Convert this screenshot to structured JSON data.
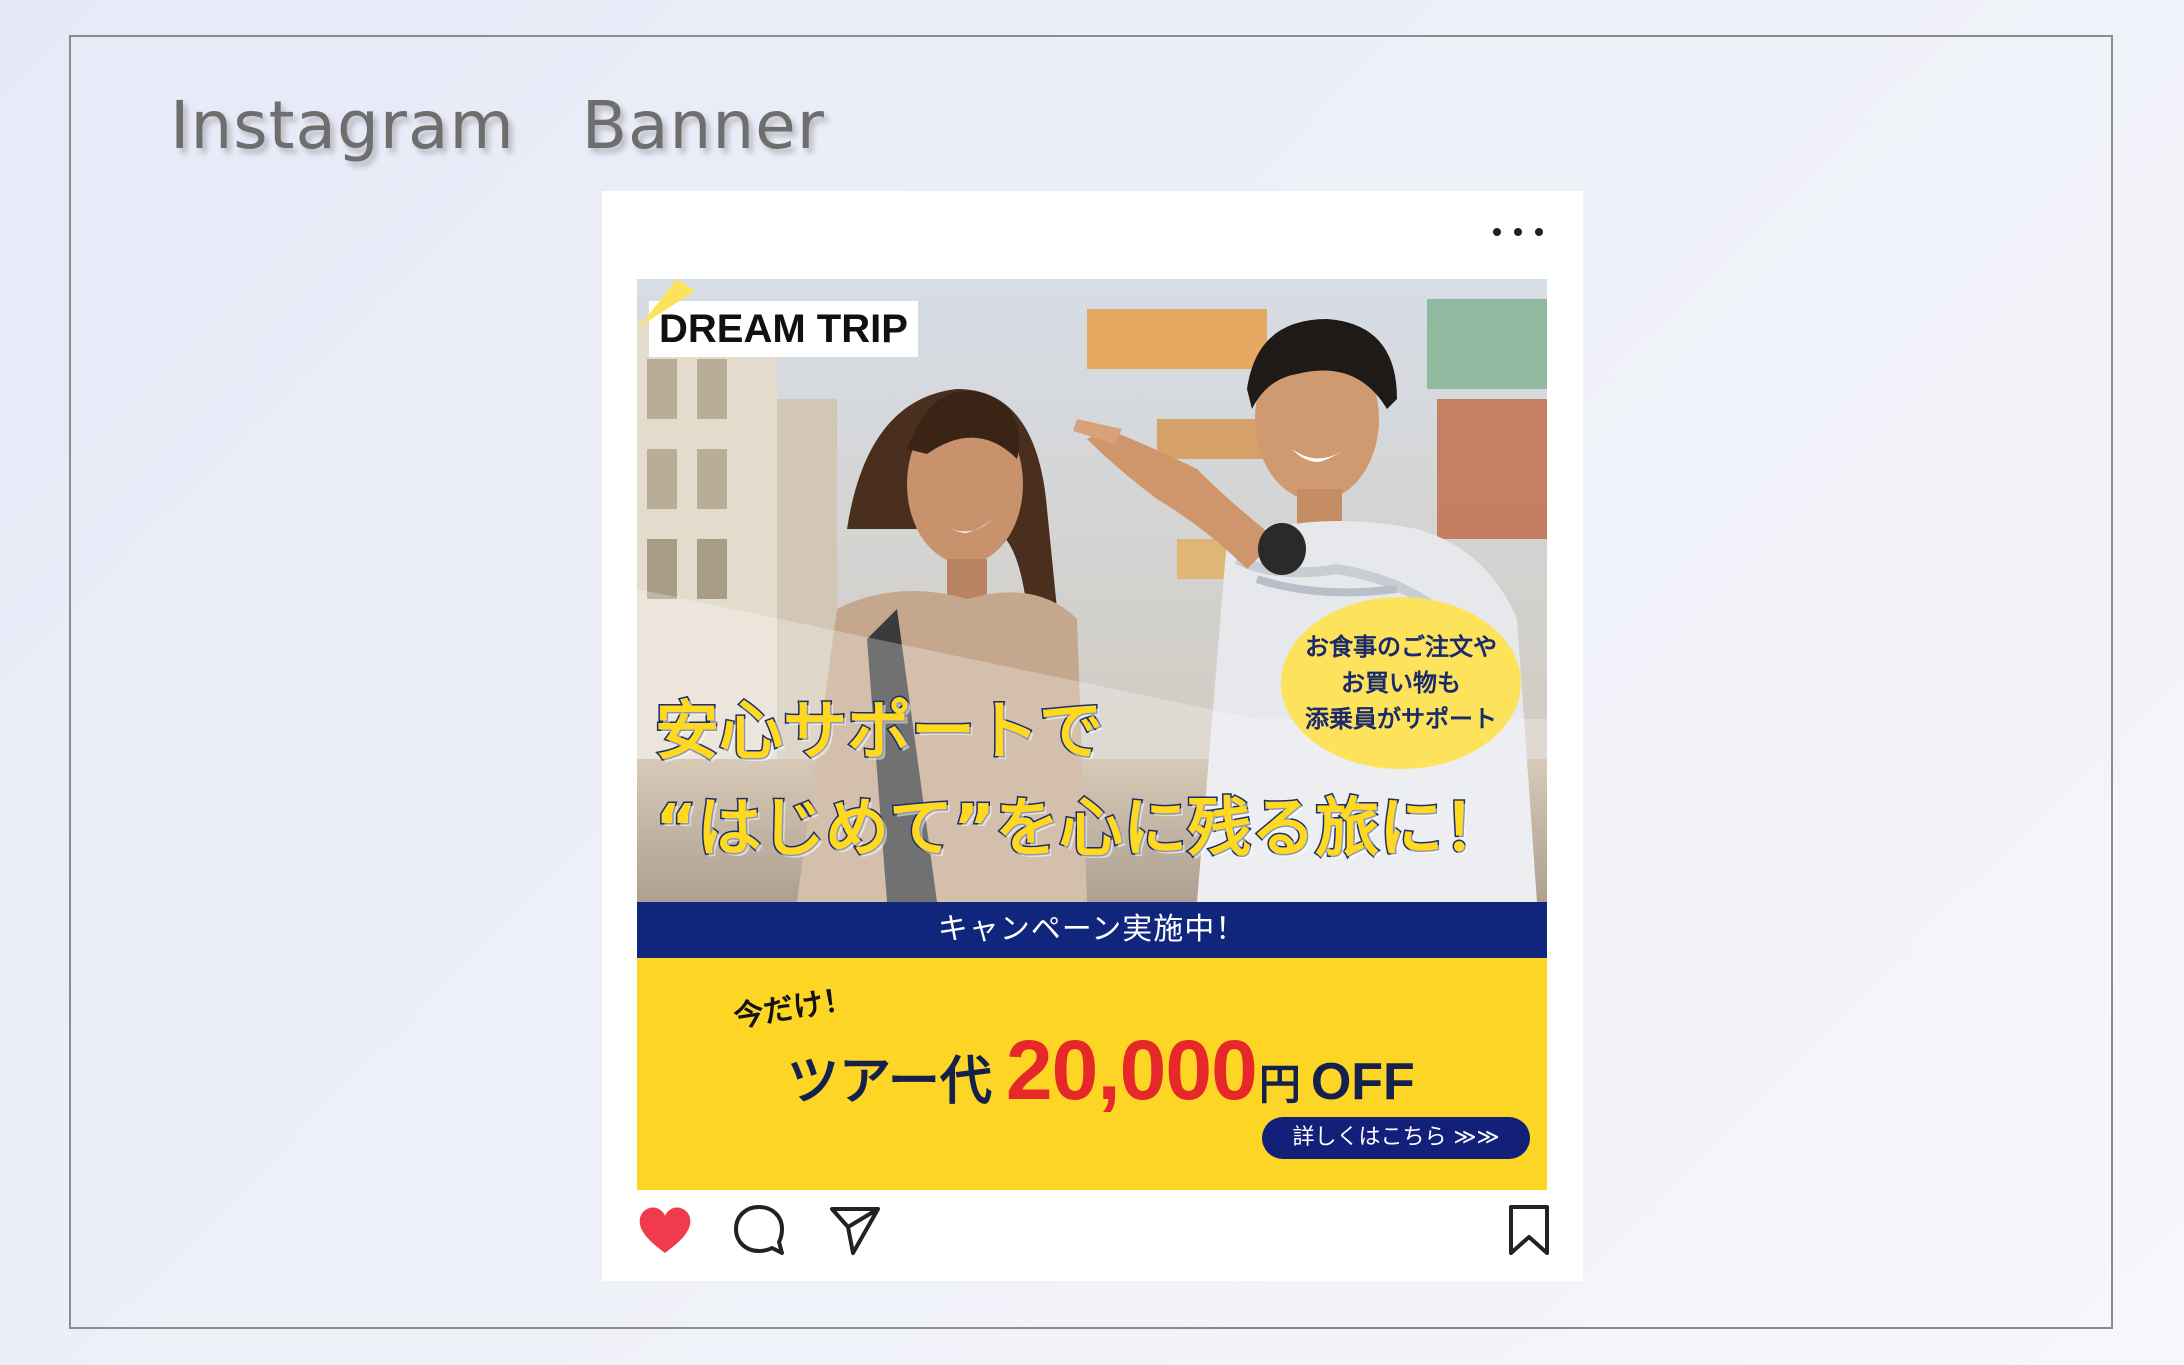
{
  "page": {
    "title": "Instagram　Banner"
  },
  "post": {
    "more_icon": "more-horizontal-icon",
    "banner": {
      "brand": "DREAM TRIP",
      "bubble_lines": [
        "お食事のご注文や",
        "お買い物も",
        "添乗員がサポート"
      ],
      "headline_line1": "安心サポートで",
      "headline_line2": "“はじめて”を心に残る旅に！",
      "campaign": "キャンペーン実施中！",
      "only_now": "今だけ！",
      "tour_label": "ツアー代",
      "price": "20,000",
      "yen": "円",
      "off": "OFF",
      "details_button": "詳しくはこちら ≫≫"
    },
    "actions": {
      "like_icon": "heart-icon",
      "comment_icon": "comment-icon",
      "share_icon": "send-icon",
      "save_icon": "bookmark-icon"
    }
  },
  "colors": {
    "navy": "#10257c",
    "yellow": "#fdd524",
    "price_red": "#e7282a",
    "heart_red": "#ef3b4d",
    "bubble_yellow": "#fde35b"
  }
}
